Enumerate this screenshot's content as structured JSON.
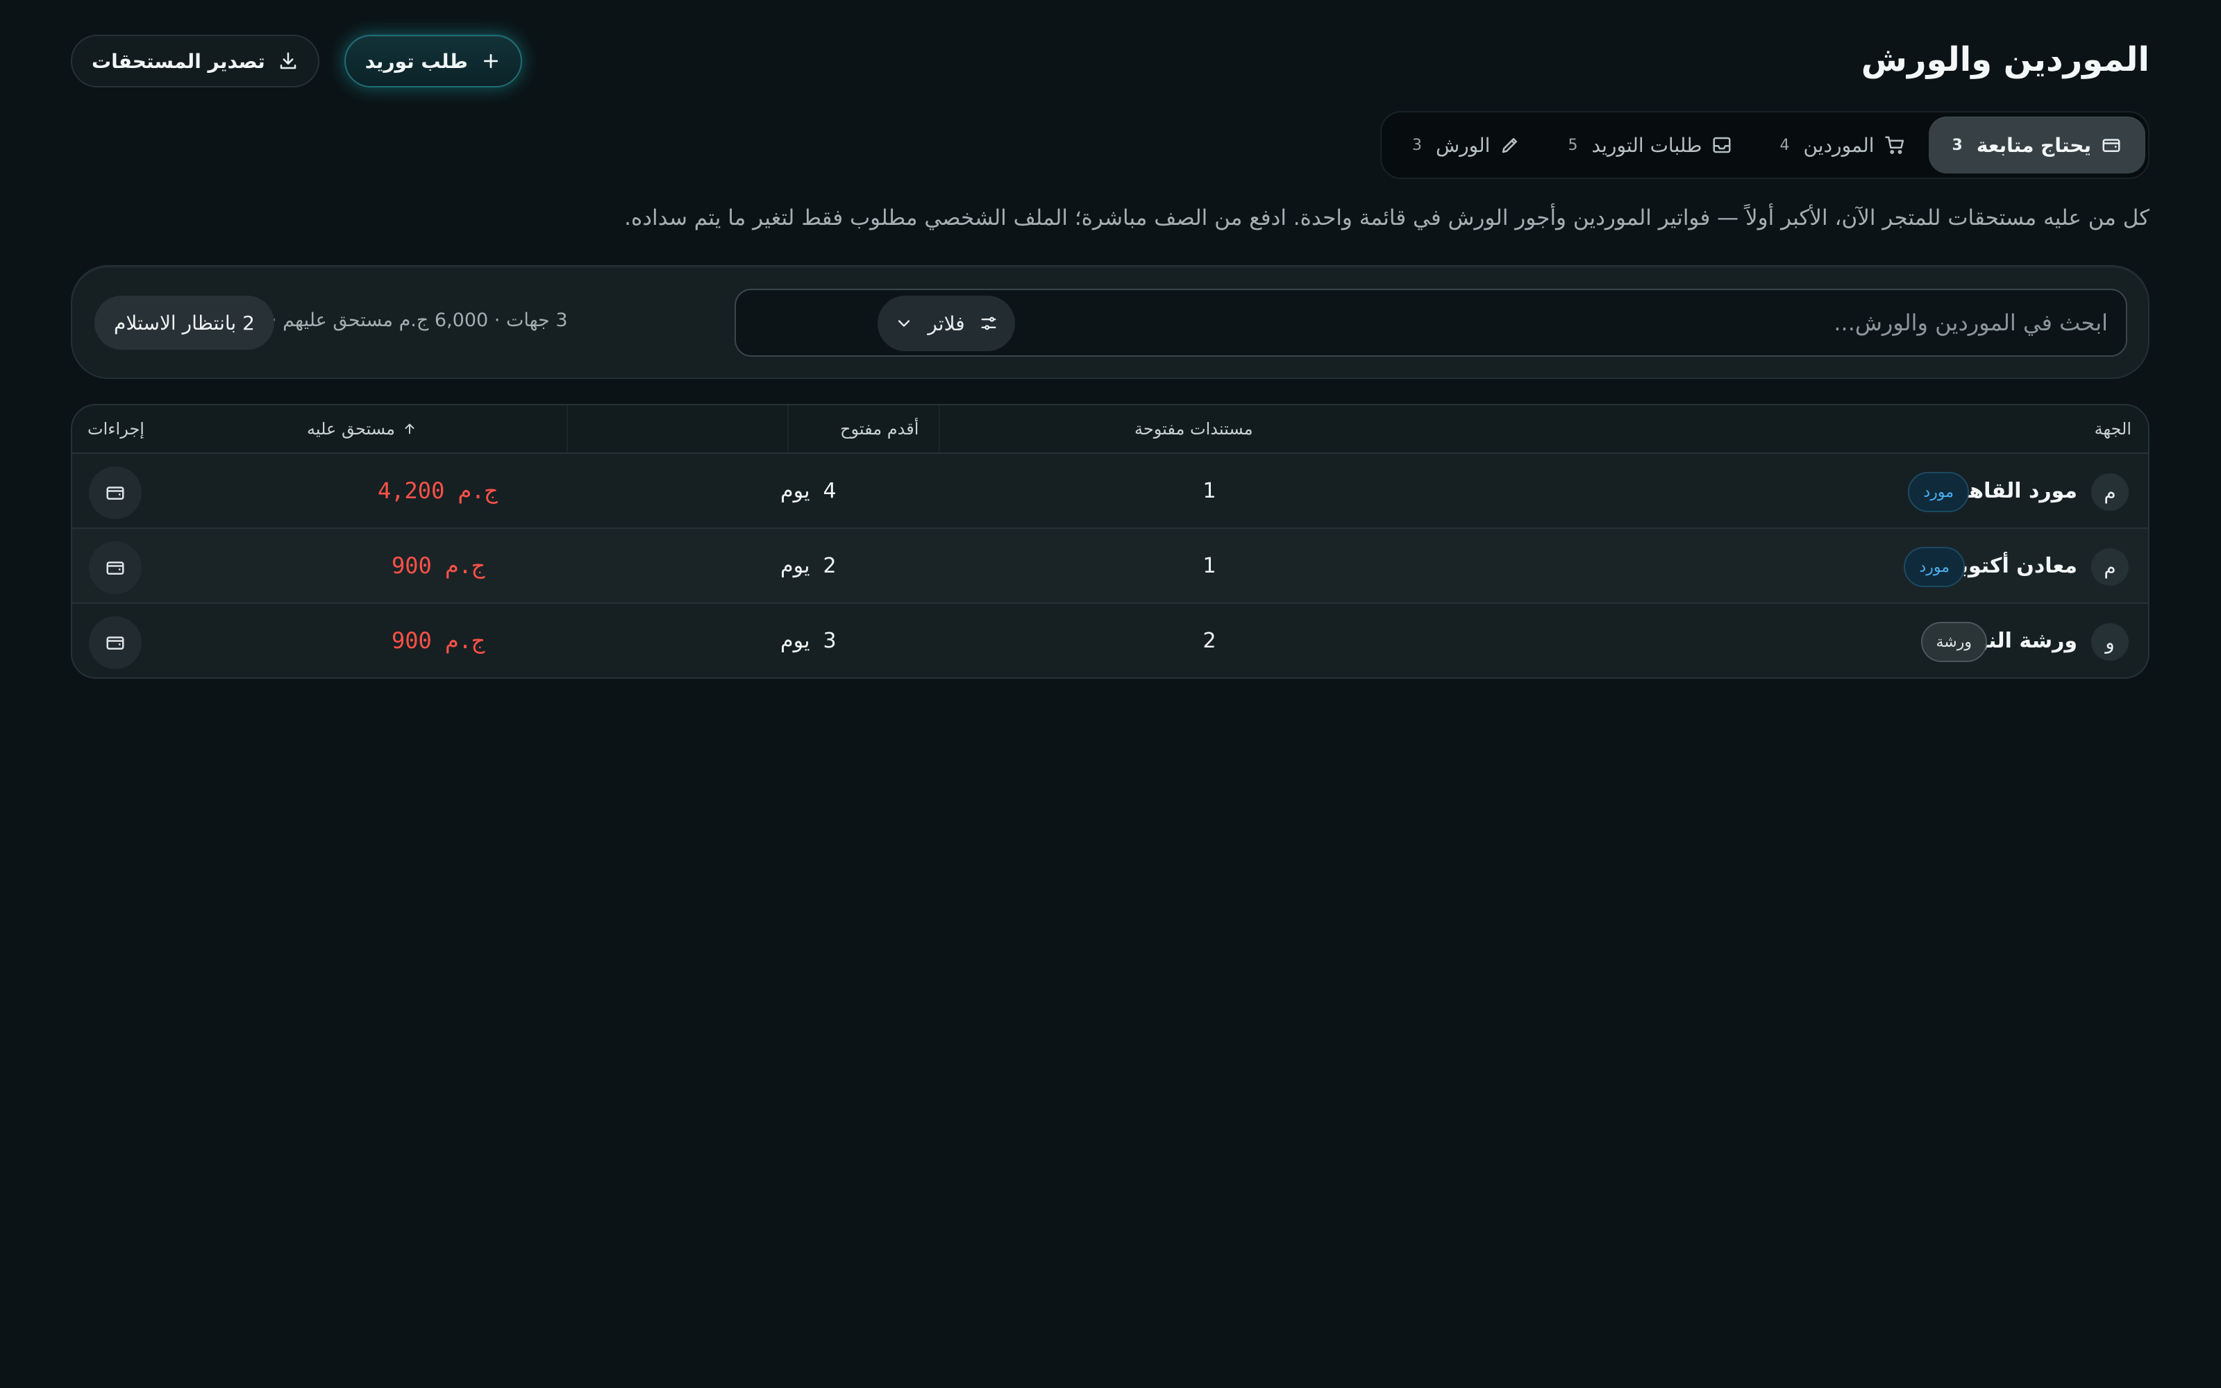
{
  "header": {
    "title": "الموردين والورش",
    "export_label": "تصدير المستحقات",
    "supply_request_label": "طلب توريد"
  },
  "tabs": [
    {
      "label": "يحتاج متابعة",
      "count": "3",
      "icon": "wallet-icon",
      "active": true
    },
    {
      "label": "الموردين",
      "count": "4",
      "icon": "cart-icon",
      "active": false
    },
    {
      "label": "طلبات التوريد",
      "count": "5",
      "icon": "inbox-icon",
      "active": false
    },
    {
      "label": "الورش",
      "count": "3",
      "icon": "pencil-icon",
      "active": false
    }
  ],
  "description": "كل من عليه مستحقات للمتجر الآن، الأكبر أولاً — فواتير الموردين وأجور الورش في قائمة واحدة. ادفع من الصف مباشرة؛ الملف الشخصي مطلوب فقط لتغير ما يتم سداده.",
  "toolbar": {
    "search_placeholder": "ابحث في الموردين والورش...",
    "filter_label": "فلاتر",
    "summary": "3 جهات · 6,000 ج.م مستحق عليهم ·",
    "pending_badge": "2 بانتظار الاستلام"
  },
  "table": {
    "columns": {
      "entity": "الجهة",
      "open_docs": "مستندات  مفتوحة",
      "oldest_open": "أقدم مفتوح",
      "due": "مستحق  عليه",
      "sort_icon": "arrow-up-icon",
      "actions": "إجراءات"
    },
    "rows": [
      {
        "initial": "م",
        "name": "مورد القاهرة",
        "type": "مورد",
        "kind": "supplier",
        "open_docs": "1",
        "oldest_days": "4",
        "days_unit": "يوم",
        "due": "4,200 ج.م"
      },
      {
        "initial": "م",
        "name": "معادن أكتوبر",
        "type": "مورد",
        "kind": "supplier",
        "open_docs": "1",
        "oldest_days": "2",
        "days_unit": "يوم",
        "due": "900 ج.م"
      },
      {
        "initial": "و",
        "name": "ورشة النور",
        "type": "ورشة",
        "kind": "workshop",
        "open_docs": "2",
        "oldest_days": "3",
        "days_unit": "يوم",
        "due": "900 ج.م"
      }
    ]
  },
  "colors": {
    "background": "#0b1316",
    "accent": "#23bec8",
    "due_text": "#ff5147",
    "supplier_badge": "#4ab0f2"
  }
}
